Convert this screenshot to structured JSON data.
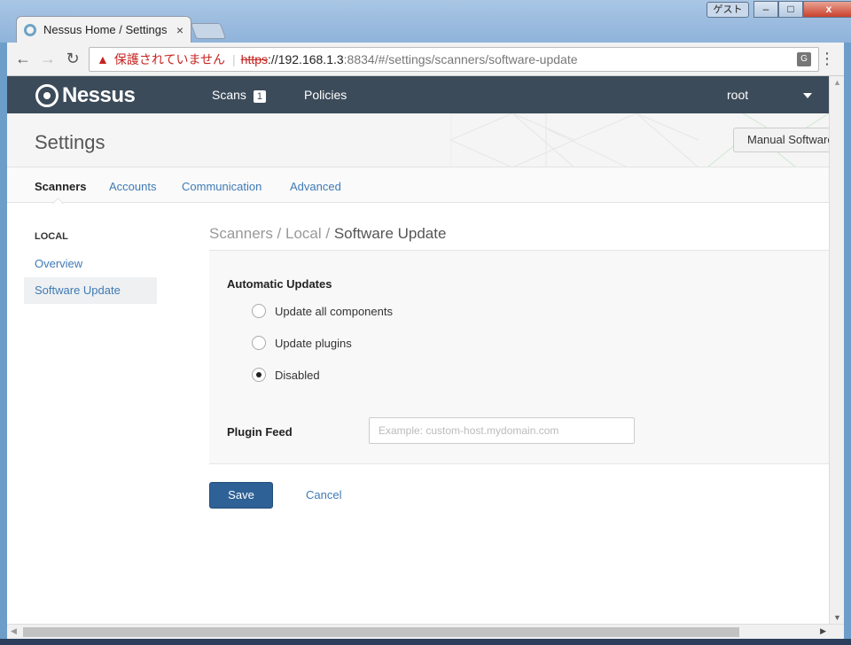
{
  "browser": {
    "tab_title": "Nessus Home / Settings",
    "tab_close": "×",
    "guest_label": "ゲスト",
    "win_min": "‒",
    "win_max": "□",
    "win_close": "x",
    "back": "←",
    "forward": "→",
    "reload": "↻",
    "warning_icon": "▲",
    "security_warning": "保護されていません",
    "separator": "|",
    "url_scheme": "https",
    "url_host": "://192.168.1.3",
    "url_path": ":8834/#/settings/scanners/software-update",
    "translate_icon": "G",
    "menu_icon": "⋮"
  },
  "topnav": {
    "logo": "Nessus",
    "scans_label": "Scans",
    "scans_count": "1",
    "policies_label": "Policies",
    "user": "root"
  },
  "header": {
    "title": "Settings",
    "manual_update_label": "Manual Software Update"
  },
  "subtabs": [
    {
      "label": "Scanners"
    },
    {
      "label": "Accounts"
    },
    {
      "label": "Communication"
    },
    {
      "label": "Advanced"
    }
  ],
  "sidebar": {
    "heading": "LOCAL",
    "items": [
      {
        "label": "Overview"
      },
      {
        "label": "Software Update"
      }
    ]
  },
  "breadcrumb": {
    "part1": "Scanners",
    "sep": " / ",
    "part2": "Local",
    "current": "Software Update"
  },
  "form": {
    "auto_updates_label": "Automatic Updates",
    "options": [
      {
        "label": "Update all components",
        "checked": false
      },
      {
        "label": "Update plugins",
        "checked": false
      },
      {
        "label": "Disabled",
        "checked": true
      }
    ],
    "plugin_feed_label": "Plugin Feed",
    "plugin_feed_value": "",
    "plugin_feed_placeholder": "Example: custom-host.mydomain.com",
    "save_label": "Save",
    "cancel_label": "Cancel"
  },
  "colors": {
    "nav_bg": "#3c4b5a",
    "primary_button": "#2e6196",
    "link": "#3f7ab5",
    "insecure_red": "#c5221f"
  }
}
